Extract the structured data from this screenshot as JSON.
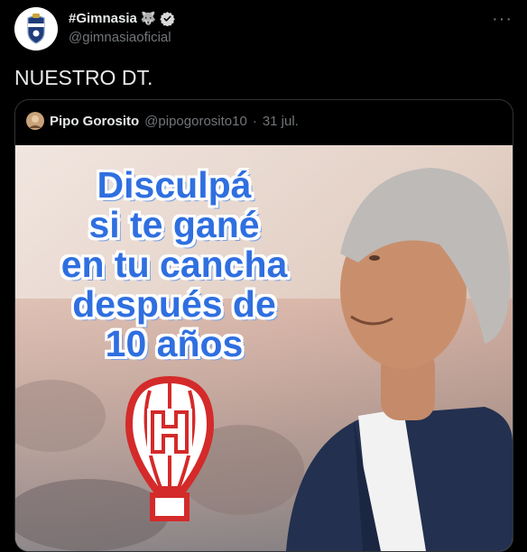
{
  "tweet": {
    "display_name": "#Gimnasia",
    "emoji": "🐺",
    "handle": "@gimnasiaoficial",
    "more": "···",
    "text": "NUESTRO DT."
  },
  "quoted": {
    "name": "Pipo Gorosito",
    "handle": "@pipogorosito10",
    "separator": "·",
    "date": "31 jul.",
    "image_text": [
      "Disculpá",
      "si te gané",
      "en tu cancha",
      "después de",
      "10 años"
    ]
  },
  "colors": {
    "background": "#000000",
    "verified": "#d9d9d9",
    "image_text": "#2f6fe0",
    "logo_red": "#d42a2a"
  },
  "icons": {
    "verified": "verified-badge-icon",
    "more": "more-options-icon"
  }
}
